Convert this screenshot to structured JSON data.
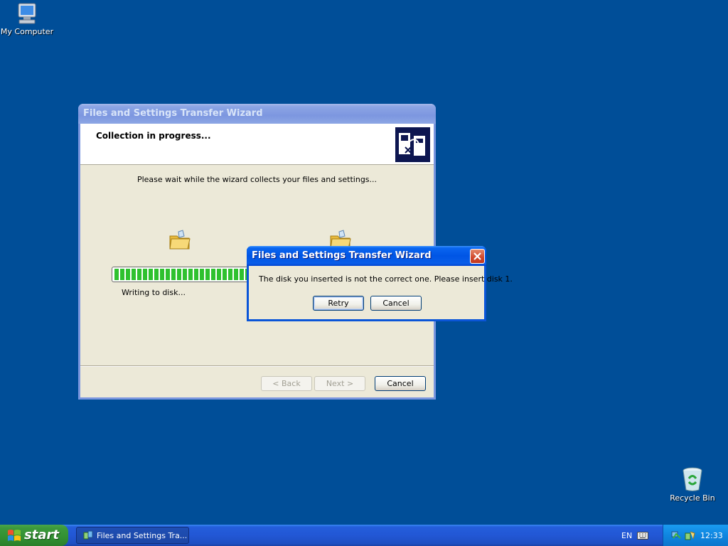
{
  "desktop": {
    "icons": [
      {
        "label": "My Computer",
        "icon": "computer-icon"
      },
      {
        "label": "Recycle Bin",
        "icon": "recycle-bin-icon"
      }
    ]
  },
  "wizard": {
    "title": "Files and Settings Transfer Wizard",
    "header_title": "Collection in progress...",
    "message": "Please wait while the wizard collects your files and settings...",
    "status": "Writing to disk...",
    "progress_fraction": 0.55,
    "buttons": {
      "back": "< Back",
      "next": "Next >",
      "cancel": "Cancel"
    }
  },
  "dialog": {
    "title": "Files and Settings Transfer Wizard",
    "message": "The disk you inserted is not the correct one. Please insert disk 1.",
    "buttons": {
      "retry": "Retry",
      "cancel": "Cancel"
    }
  },
  "taskbar": {
    "start_label": "start",
    "task_item": "Files and Settings Tra...",
    "language": "EN",
    "clock": "12:33"
  },
  "colors": {
    "desktop": "#004e98",
    "progress": "#2fc12f",
    "title_active": "#0055e5",
    "close_button": "#d0462a"
  }
}
